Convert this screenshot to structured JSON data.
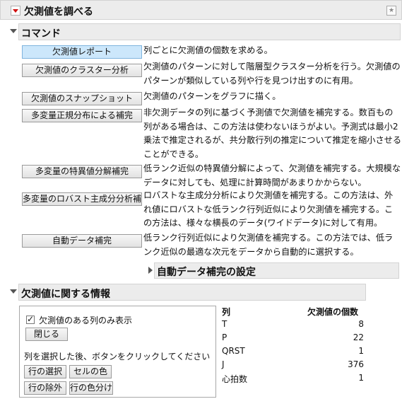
{
  "window": {
    "title": "欠測値を調べる"
  },
  "commands": {
    "title": "コマンド",
    "items": [
      {
        "label": "欠測値レポート",
        "desc": "列ごとに欠測値の個数を求める。",
        "selected": true
      },
      {
        "label": "欠測値のクラスター分析",
        "desc": "欠測値のパターンに対して階層型クラスター分析を行う。欠測値のパターンが類似している列や行を見つけ出すのに有用。"
      },
      {
        "label": "欠測値のスナップショット",
        "desc": "欠測値のパターンをグラフに描く。"
      },
      {
        "label": "多変量正規分布による補完",
        "desc": "非欠測データの列に基づく予測値で欠測値を補完する。数百もの列がある場合は、この方法は使わないほうがよい。予測式は最小2乗法で推定されるが、共分散行列の推定について推定を縮小させることができる。"
      },
      {
        "label": "多変量の特異値分解補完",
        "desc": "低ランク近似の特異値分解によって、欠測値を補完する。大規模なデータに対しても、処理に計算時間があまりかからない。"
      },
      {
        "label": "多変量のロバスト主成分分析補完",
        "desc": "ロバストな主成分分析により欠測値を補完する。この方法は、外れ値にロバストな低ランク行列近似により欠測値を補完する。この方法は、様々な横長のデータ(ワイドデータ)に対して有用。"
      },
      {
        "label": "自動データ補完",
        "desc": "低ランク行列近似により欠測値を補完する。この方法では、低ランク近似の最適な次元をデータから自動的に選択する。"
      }
    ],
    "auto_settings_title": "自動データ補完の設定"
  },
  "info": {
    "title": "欠測値に関する情報",
    "checkbox_label": "欠測値のある列のみ表示",
    "checkbox_checked": true,
    "close_label": "閉じる",
    "instruction": "列を選択した後、ボタンをクリックしてください",
    "buttons": {
      "select_rows": "行の選択",
      "cell_color": "セルの色",
      "exclude_rows": "行の除外",
      "color_rows": "行の色分け"
    },
    "table": {
      "headers": [
        "列",
        "欠測値の個数"
      ],
      "rows": [
        {
          "col": "T",
          "count": "8"
        },
        {
          "col": "P",
          "count": "22"
        },
        {
          "col": "QRST",
          "count": "1"
        },
        {
          "col": "J",
          "count": "376"
        },
        {
          "col": "心拍数",
          "count": "1"
        }
      ]
    }
  }
}
